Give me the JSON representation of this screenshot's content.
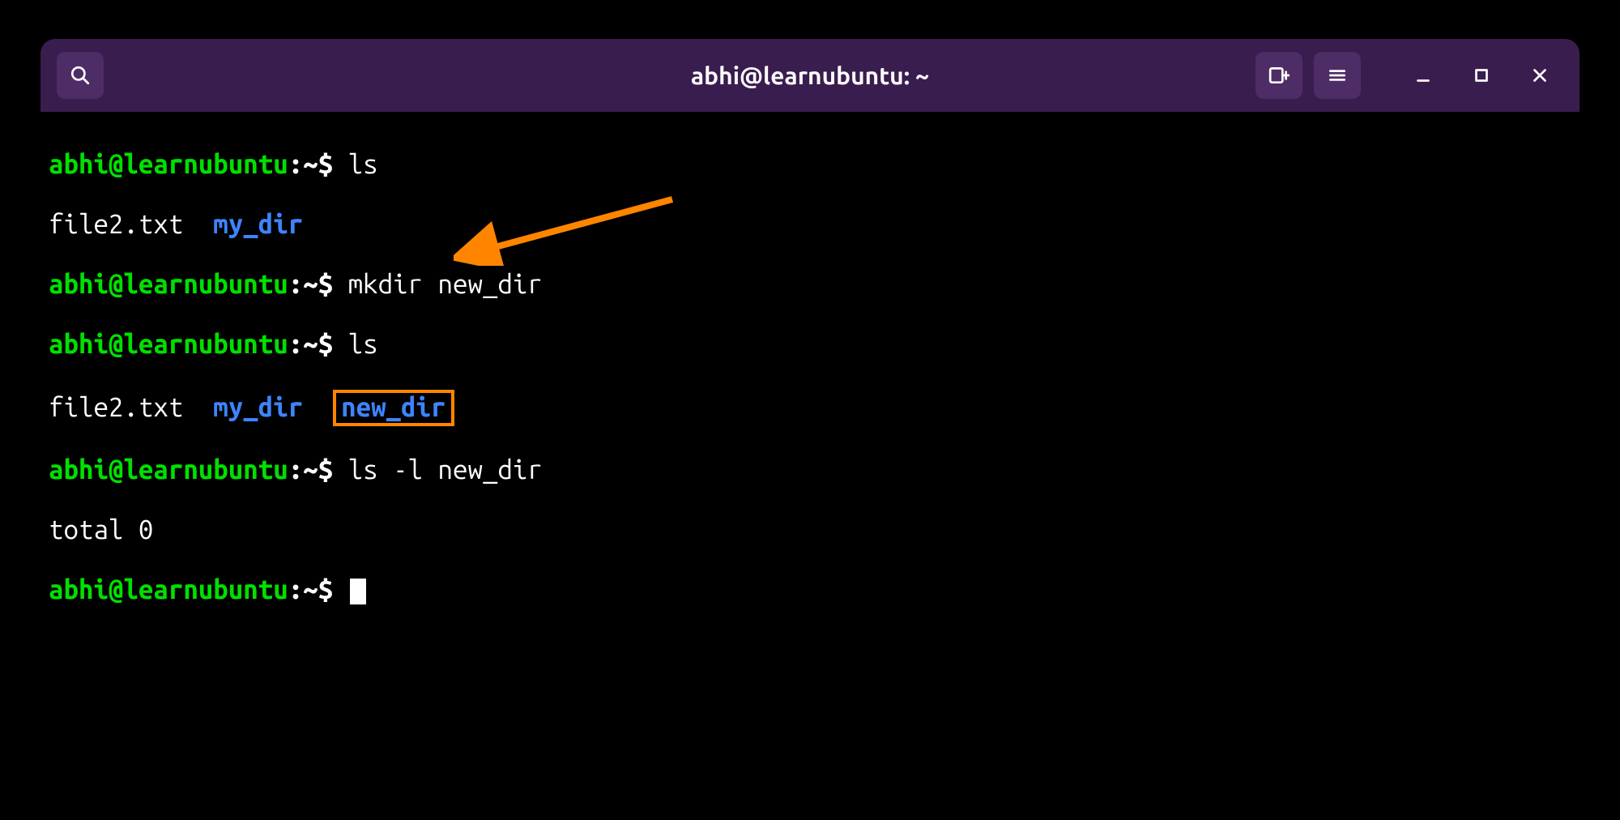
{
  "window": {
    "title": "abhi@learnubuntu: ~"
  },
  "prompt": {
    "user_host": "abhi@learnubuntu",
    "sep1": ":",
    "path": "~",
    "symbol": "$"
  },
  "lines": {
    "l1_cmd": "ls",
    "l2_file": "file2.txt",
    "l2_dir": "my_dir",
    "l3_cmd": "mkdir new_dir",
    "l4_cmd": "ls",
    "l5_file": "file2.txt",
    "l5_dir1": "my_dir",
    "l5_dir2": "new_dir",
    "l6_cmd": "ls -l new_dir",
    "l7_out": "total 0"
  },
  "icons": {
    "search": "search-icon",
    "newtab": "new-tab-icon",
    "menu": "hamburger-menu-icon",
    "minimize": "minimize-icon",
    "maximize": "maximize-icon",
    "close": "close-icon"
  }
}
